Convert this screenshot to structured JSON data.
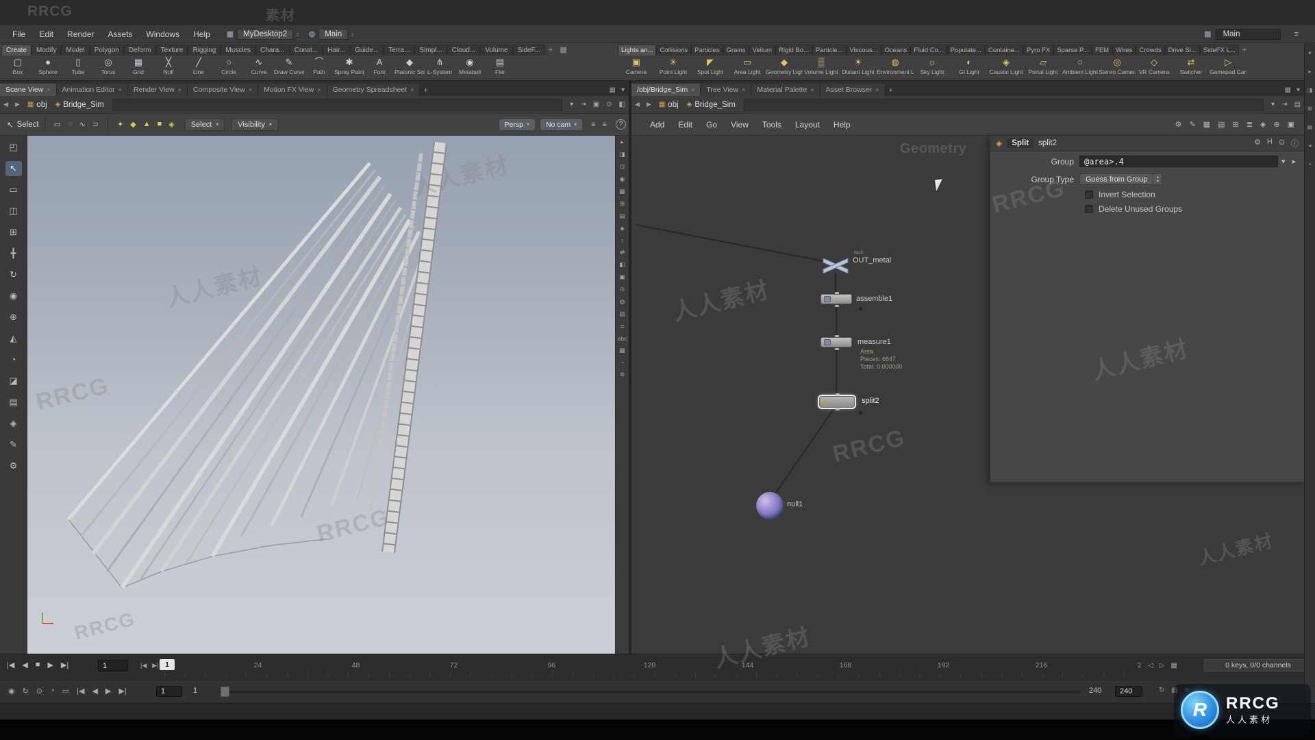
{
  "titlebar": {
    "brand": "RRCG"
  },
  "menubar": {
    "items": [
      "File",
      "Edit",
      "Render",
      "Assets",
      "Windows",
      "Help"
    ],
    "desktop": "MyDesktop2",
    "radial": "Main",
    "right_field": "Main"
  },
  "icons": {
    "monitor": "▦",
    "updown": "↕",
    "radial": "◍",
    "grid": "▦",
    "grip": "≡",
    "caret": "▾",
    "close": "×",
    "plus": "+",
    "back": "◀",
    "forward": "▶",
    "help": "?",
    "tri": "▸",
    "up": "▴",
    "down": "▾"
  },
  "shelf": {
    "left_tabs": [
      "Create",
      "Modify",
      "Model",
      "Polygon",
      "Deform",
      "Texture",
      "Rigging",
      "Muscles",
      "Chara...",
      "Const...",
      "Hair...",
      "Guide...",
      "Terra...",
      "Simpl...",
      "Cloud...",
      "Volume",
      "SideF..."
    ],
    "right_tabs": [
      "Lights an...",
      "Collisions",
      "Particles",
      "Grains",
      "Vellum",
      "Rigid Bo...",
      "Particle...",
      "Viscous...",
      "Oceans",
      "Fluid Co...",
      "Populate...",
      "Containe...",
      "Pyro FX",
      "Sparse P...",
      "FEM",
      "Wires",
      "Crowds",
      "Drive Si...",
      "SideFX L..."
    ],
    "left_tools": [
      {
        "g": "▢",
        "label": "Box"
      },
      {
        "g": "●",
        "label": "Sphere"
      },
      {
        "g": "▯",
        "label": "Tube"
      },
      {
        "g": "◎",
        "label": "Torus"
      },
      {
        "g": "▦",
        "label": "Grid"
      },
      {
        "g": "╳",
        "label": "Null"
      },
      {
        "g": "╱",
        "label": "Line"
      },
      {
        "g": "○",
        "label": "Circle"
      },
      {
        "g": "∿",
        "label": "Curve"
      },
      {
        "g": "✎",
        "label": "Draw Curve"
      },
      {
        "g": "⌒",
        "label": "Path"
      },
      {
        "g": "✱",
        "label": "Spray Paint"
      },
      {
        "g": "A",
        "label": "Font"
      },
      {
        "g": "◆",
        "label": "Platonic Solids"
      },
      {
        "g": "⋔",
        "label": "L-System"
      },
      {
        "g": "◉",
        "label": "Metaball"
      },
      {
        "g": "▤",
        "label": "File"
      }
    ],
    "right_tools": [
      {
        "g": "▣",
        "label": "Camera"
      },
      {
        "g": "✳",
        "label": "Point Light"
      },
      {
        "g": "◤",
        "label": "Spot Light"
      },
      {
        "g": "▭",
        "label": "Area Light"
      },
      {
        "g": "◆",
        "label": "Geometry Light"
      },
      {
        "g": "▒",
        "label": "Volume Light"
      },
      {
        "g": "☀",
        "label": "Distant Light"
      },
      {
        "g": "◍",
        "label": "Environment Light"
      },
      {
        "g": "☼",
        "label": "Sky Light"
      },
      {
        "g": "◐",
        "label": "GI Light"
      },
      {
        "g": "◈",
        "label": "Caustic Light"
      },
      {
        "g": "▱",
        "label": "Portal Light"
      },
      {
        "g": "○",
        "label": "Ambient Light"
      },
      {
        "g": "◎",
        "label": "Stereo Camera"
      },
      {
        "g": "◇",
        "label": "VR Camera"
      },
      {
        "g": "⇄",
        "label": "Switcher"
      },
      {
        "g": "▷",
        "label": "Gamepad Camera"
      }
    ]
  },
  "panes": {
    "left_tabs": [
      "Scene View",
      "Animation Editor",
      "Render View",
      "Composite View",
      "Motion FX View",
      "Geometry Spreadsheet"
    ],
    "right_tabs": [
      "/obj/Bridge_Sim",
      "Tree View",
      "Material Palette",
      "Asset Browser"
    ]
  },
  "path": {
    "icon1": "▦",
    "crumb1": "obj",
    "icon2": "◈",
    "crumb2": "Bridge_Sim"
  },
  "pathbar": {
    "left_icons": [
      "⇥",
      "▣",
      "⊙",
      "◧"
    ],
    "right_icons": [
      "⇥",
      "▤"
    ]
  },
  "toolbar_left": {
    "tool_icon": "↖",
    "tool_label": "Select",
    "icons_a": [
      "▭",
      "◌",
      "∿",
      "⊃"
    ],
    "icons_b": [
      "✦",
      "◆",
      "▲",
      "■",
      "◈"
    ],
    "select_dd": "Select",
    "visibility_dd": "Visibility",
    "persp": "Persp",
    "nocam": "No cam",
    "icons_c": [
      "≡",
      "≡"
    ]
  },
  "network_toolbar": {
    "menus": [
      "Add",
      "Edit",
      "Go",
      "View",
      "Tools",
      "Layout",
      "Help"
    ],
    "icons": [
      "⚙",
      "✎",
      "▦",
      "▤",
      "⊞",
      "≣",
      "◈",
      "⊕",
      "▣"
    ]
  },
  "left_toolcol": [
    "◰",
    "↖",
    "▭",
    "◫",
    "⊞",
    "╋",
    "↻",
    "◉",
    "⊕",
    "◭",
    "◔",
    "◪",
    "▤",
    "◈",
    "✎",
    "⚙"
  ],
  "viewport": {
    "right_icons": [
      "▸",
      "◨",
      "⊡",
      "◉",
      "▦",
      "⊞",
      "▤",
      "◈",
      "↕",
      "⇄",
      "◧",
      "▣",
      "⊙",
      "◍",
      "▥",
      "≣",
      "abc",
      "▦",
      "◔",
      "⊚"
    ]
  },
  "network": {
    "label": "Geometry",
    "nodes": {
      "out_metal": {
        "type_label": "Null",
        "name": "OUT_metal"
      },
      "assemble": {
        "name": "assemble1"
      },
      "measure": {
        "name": "measure1",
        "info1": "Area",
        "info2": "Pieces: 6647",
        "info3": "Total: 0.000000"
      },
      "split": {
        "name": "split2",
        "flag": "▶"
      },
      "null1": {
        "name": "null1"
      }
    }
  },
  "params": {
    "node_icon": "◈",
    "type_label": "Split",
    "name": "split2",
    "header_icons": [
      "⚙",
      "H",
      "⊙",
      "ⓘ"
    ],
    "group_label": "Group",
    "group_value": "@area>.4",
    "group_type_label": "Group Type",
    "group_type_value": "Guess from Group",
    "checks": [
      "Invert Selection",
      "Delete Unused Groups"
    ]
  },
  "timeline": {
    "transport": [
      "|◀",
      "◀",
      "■",
      "▶",
      "▶|"
    ],
    "frame_field": "1",
    "nudge": [
      "|◀",
      "▶|"
    ],
    "marker": "1",
    "ticks": [
      "24",
      "48",
      "72",
      "96",
      "120",
      "144",
      "168",
      "192",
      "216",
      "2"
    ],
    "right_icons": [
      "◁",
      "▷",
      "▦"
    ],
    "keys": "0 keys, 0/0 channels"
  },
  "playbar": {
    "icons": [
      "◉",
      "↻",
      "⊙",
      "◔",
      "▭",
      "|◀",
      "◀",
      "▶",
      "▶|"
    ],
    "frame_field": "1",
    "current": "1",
    "end_label": "240",
    "end_value": "240",
    "right_icons": [
      "↻",
      "▦",
      "≡"
    ]
  },
  "right_strip": [
    "▾",
    "▸",
    "◨",
    "⊞",
    "▤",
    "◂",
    "▪"
  ],
  "watermarks": [
    "素材",
    "人人素材",
    "人人素材",
    "RRCG",
    "RRCG",
    "RRCG",
    "人人素材",
    "RRCG",
    "人人素材",
    "RRCG",
    "人人素材",
    "人人素材"
  ],
  "logo": {
    "letter": "R",
    "brand": "RRCG",
    "cn": "人人素材"
  }
}
